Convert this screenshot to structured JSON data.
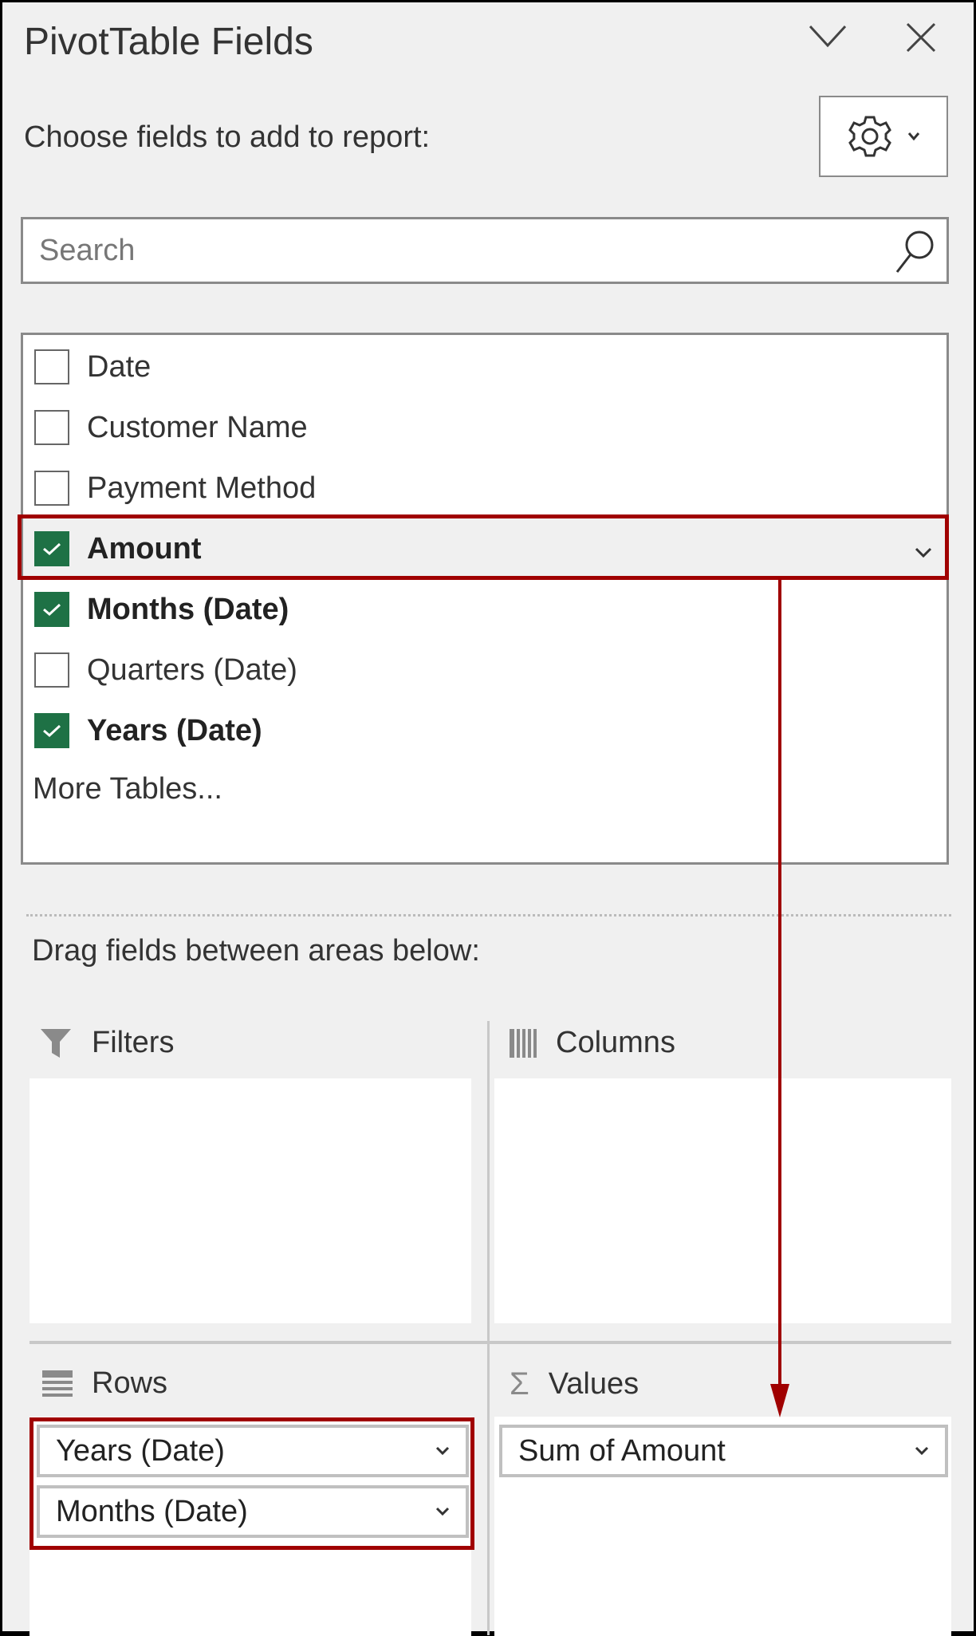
{
  "header": {
    "title": "PivotTable Fields",
    "collapse_icon": "chevron-down-icon",
    "close_icon": "close-icon"
  },
  "choose_label": "Choose fields to add to report:",
  "search": {
    "placeholder": "Search"
  },
  "fields": [
    {
      "label": "Date",
      "checked": false
    },
    {
      "label": "Customer Name",
      "checked": false
    },
    {
      "label": "Payment Method",
      "checked": false
    },
    {
      "label": "Amount",
      "checked": true
    },
    {
      "label": "Months (Date)",
      "checked": true
    },
    {
      "label": "Quarters (Date)",
      "checked": false
    },
    {
      "label": "Years (Date)",
      "checked": true
    }
  ],
  "more_tables": "More Tables...",
  "drag_label": "Drag fields between areas below:",
  "areas": {
    "filters": {
      "label": "Filters"
    },
    "columns": {
      "label": "Columns"
    },
    "rows": {
      "label": "Rows",
      "items": [
        "Years (Date)",
        "Months (Date)"
      ]
    },
    "values": {
      "label": "Values",
      "items": [
        "Sum of Amount"
      ]
    }
  },
  "colors": {
    "accent_check": "#1e7145",
    "highlight": "#a00000"
  }
}
